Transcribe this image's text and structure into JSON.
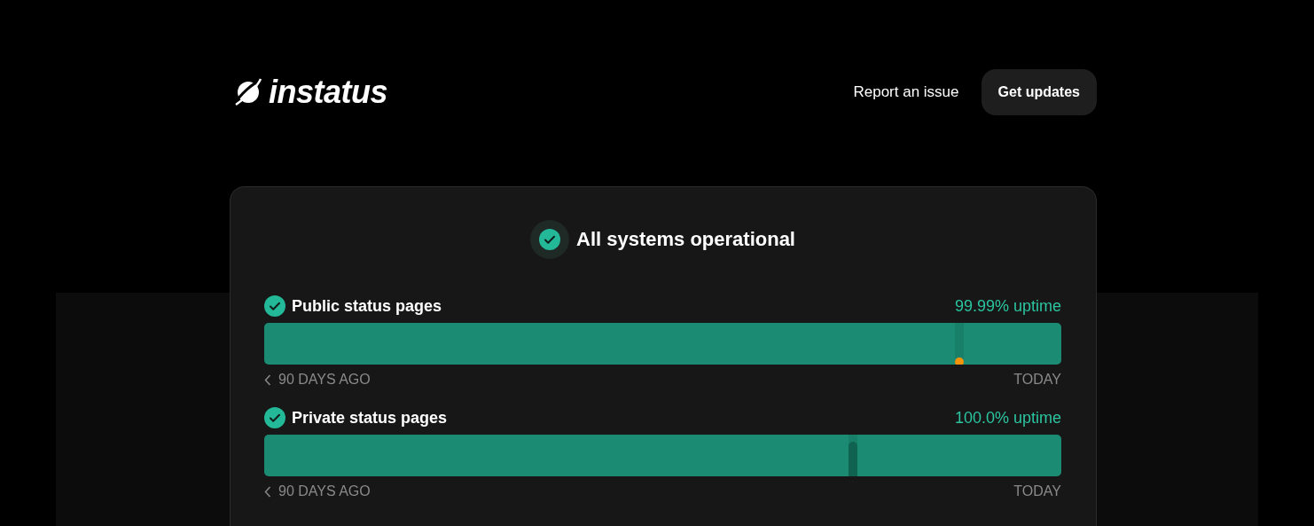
{
  "header": {
    "logo": "instatus",
    "nav": [
      {
        "label": "Report an issue",
        "kind": "link"
      },
      {
        "label": "Get updates",
        "kind": "button"
      }
    ]
  },
  "status": {
    "title": "All systems operational"
  },
  "components": [
    {
      "name": "Public status pages",
      "uptime": "99.99% uptime",
      "start": "90 DAYS AGO",
      "end": "TODAY",
      "marker": {
        "kind": "minor"
      }
    },
    {
      "name": "Private status pages",
      "uptime": "100.0% uptime",
      "start": "90 DAYS AGO",
      "end": "TODAY",
      "marker": {
        "kind": "notice"
      }
    }
  ]
}
